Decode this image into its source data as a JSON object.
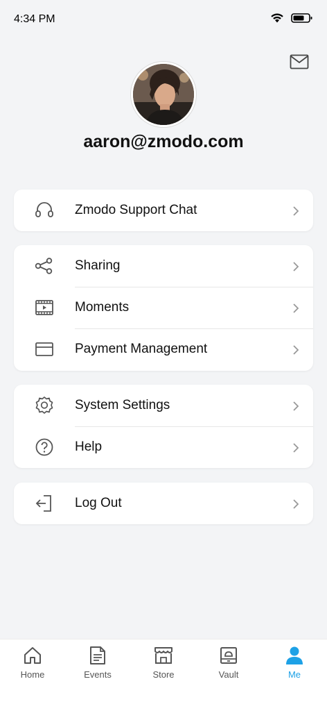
{
  "status_bar": {
    "time": "4:34 PM",
    "battery_icon": "battery-icon",
    "wifi_icon": "wifi-icon"
  },
  "header": {
    "mail_icon": "mail-icon"
  },
  "profile": {
    "email": "aaron@zmodo.com"
  },
  "menu": {
    "support_chat": "Zmodo Support Chat",
    "sharing": "Sharing",
    "moments": "Moments",
    "payment_management": "Payment Management",
    "system_settings": "System Settings",
    "help": "Help",
    "log_out": "Log Out"
  },
  "tabs": [
    {
      "label": "Home",
      "icon": "home-icon"
    },
    {
      "label": "Events",
      "icon": "document-icon"
    },
    {
      "label": "Store",
      "icon": "store-icon"
    },
    {
      "label": "Vault",
      "icon": "vault-icon"
    },
    {
      "label": "Me",
      "icon": "person-icon",
      "active": true
    }
  ],
  "colors": {
    "accent": "#1da1e6",
    "background": "#f3f4f6",
    "card": "#ffffff",
    "icon": "#555555"
  }
}
